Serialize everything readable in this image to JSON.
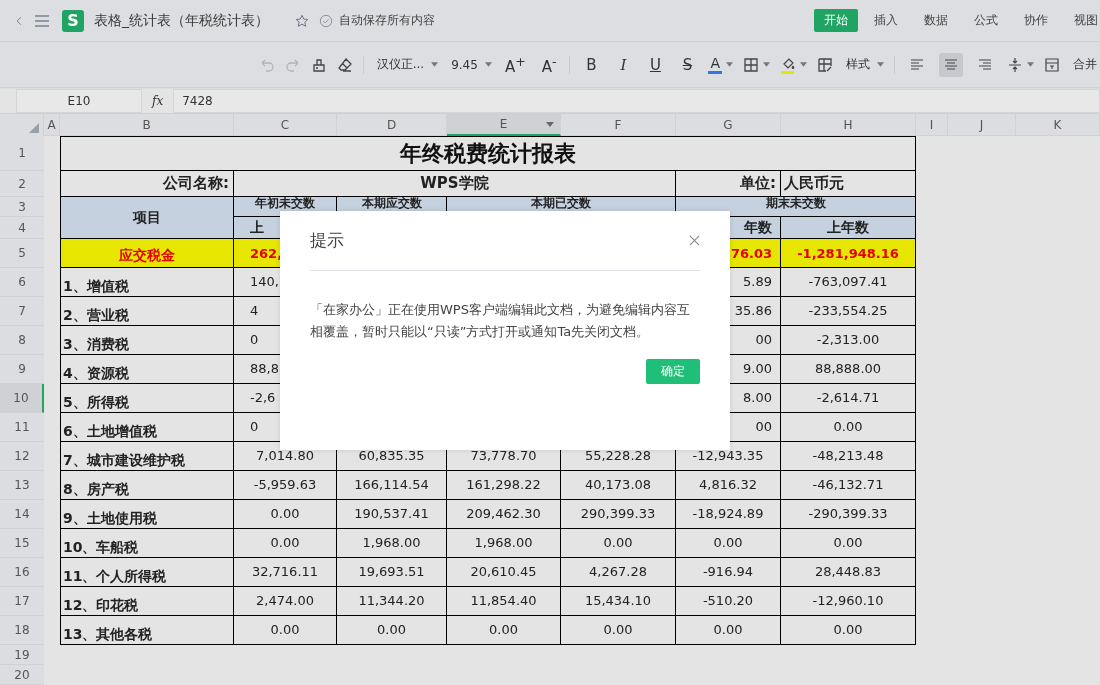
{
  "app": {
    "logo": "S",
    "title": "表格_统计表（年税统计表）",
    "save_status": "自动保存所有内容",
    "tabs": [
      {
        "label": "开始",
        "selected": true
      },
      {
        "label": "插入",
        "selected": false
      },
      {
        "label": "数据",
        "selected": false
      },
      {
        "label": "公式",
        "selected": false
      },
      {
        "label": "协作",
        "selected": false
      },
      {
        "label": "视图",
        "selected": false
      }
    ]
  },
  "toolbar": {
    "font": "汉仪正...",
    "size": "9.45",
    "grow": "A$^{+}$",
    "shrink": "A$^{-}$",
    "format_buttons": [
      "B",
      "I",
      "U",
      "S"
    ],
    "font_color": "A",
    "style_button": "样式",
    "align_buttons": [
      {
        "selected": false
      },
      {
        "selected": true
      },
      {
        "selected": false
      }
    ],
    "merge_button": "合并"
  },
  "formula_bar": {
    "cell_ref": "E10",
    "fx": "fx",
    "formula": "7428"
  },
  "columns": [
    {
      "label": "A",
      "selected": false
    },
    {
      "label": "B",
      "selected": false
    },
    {
      "label": "C",
      "selected": false
    },
    {
      "label": "D",
      "selected": false
    },
    {
      "label": "E",
      "selected": true
    },
    {
      "label": "F",
      "selected": false
    },
    {
      "label": "G",
      "selected": false
    },
    {
      "label": "H",
      "selected": false
    },
    {
      "label": "I",
      "selected": false
    },
    {
      "label": "J",
      "selected": false
    },
    {
      "label": "K",
      "selected": false
    }
  ],
  "row_numbers": [
    {
      "label": "1",
      "selected": false
    },
    {
      "label": "2",
      "selected": false
    },
    {
      "label": "3",
      "selected": false
    },
    {
      "label": "4",
      "selected": false
    },
    {
      "label": "5",
      "selected": false
    },
    {
      "label": "6",
      "selected": false
    },
    {
      "label": "7",
      "selected": false
    },
    {
      "label": "8",
      "selected": false
    },
    {
      "label": "9",
      "selected": false
    },
    {
      "label": "10",
      "selected": true
    },
    {
      "label": "11",
      "selected": false
    },
    {
      "label": "12",
      "selected": false
    },
    {
      "label": "13",
      "selected": false
    },
    {
      "label": "14",
      "selected": false
    },
    {
      "label": "15",
      "selected": false
    },
    {
      "label": "16",
      "selected": false
    },
    {
      "label": "17",
      "selected": false
    },
    {
      "label": "18",
      "selected": false
    },
    {
      "label": "19",
      "selected": false
    },
    {
      "label": "20",
      "selected": false
    }
  ],
  "sheet": {
    "title": "年终税费统计报表",
    "company_label": "公司名称:",
    "company": "WPS学院",
    "unit_label": "单位:",
    "unit": "人民币元",
    "item_header": "项目",
    "group_headers": [
      "年初未交数",
      "本期应交数",
      "本期已交数",
      "期末未交数"
    ],
    "sub_headers": {
      "c": "上",
      "g": "年数",
      "h": "上年数"
    },
    "total": {
      "label": "应交税金",
      "c": "262,",
      "g": "76.03",
      "h": "-1,281,948.16"
    },
    "rows": [
      {
        "label": "1、增值税",
        "c": "140,",
        "g": "5.89",
        "h": "-763,097.41"
      },
      {
        "label": "2、营业税",
        "c": "4",
        "g": "35.86",
        "h": "-233,554.25"
      },
      {
        "label": "3、消费税",
        "c": "0",
        "g": "00",
        "h": "-2,313.00"
      },
      {
        "label": "4、资源税",
        "c": "88,8",
        "g": "9.00",
        "h": "88,888.00"
      },
      {
        "label": "5、所得税",
        "c": "-2,6",
        "g": "8.00",
        "h": "-2,614.71"
      },
      {
        "label": "6、土地增值税",
        "c": "0",
        "g": "00",
        "h": "0.00"
      },
      {
        "label": "7、城市建设维护税",
        "c": "7,014.80",
        "d": "60,835.35",
        "e": "73,778.70",
        "f": "55,228.28",
        "g": "-12,943.35",
        "h": "-48,213.48"
      },
      {
        "label": "8、房产税",
        "c": "-5,959.63",
        "d": "166,114.54",
        "e": "161,298.22",
        "f": "40,173.08",
        "g": "4,816.32",
        "h": "-46,132.71"
      },
      {
        "label": "9、土地使用税",
        "c": "0.00",
        "d": "190,537.41",
        "e": "209,462.30",
        "f": "290,399.33",
        "g": "-18,924.89",
        "h": "-290,399.33"
      },
      {
        "label": "10、车船税",
        "c": "0.00",
        "d": "1,968.00",
        "e": "1,968.00",
        "f": "0.00",
        "g": "0.00",
        "h": "0.00"
      },
      {
        "label": "11、个人所得税",
        "c": "32,716.11",
        "d": "19,693.51",
        "e": "20,610.45",
        "f": "4,267.28",
        "g": "-916.94",
        "h": "28,448.83"
      },
      {
        "label": "12、印花税",
        "c": "2,474.00",
        "d": "11,344.20",
        "e": "11,854.40",
        "f": "15,434.10",
        "g": "-510.20",
        "h": "-12,960.10"
      },
      {
        "label": "13、其他各税",
        "c": "0.00",
        "d": "0.00",
        "e": "0.00",
        "f": "0.00",
        "g": "0.00",
        "h": "0.00"
      }
    ]
  },
  "dialog": {
    "title": "提示",
    "message": "「在家办公」正在使用WPS客户端编辑此文档，为避免编辑内容互相覆盖，暂时只能以“只读”方式打开或通知Ta先关闭文档。",
    "confirm": "确定"
  }
}
